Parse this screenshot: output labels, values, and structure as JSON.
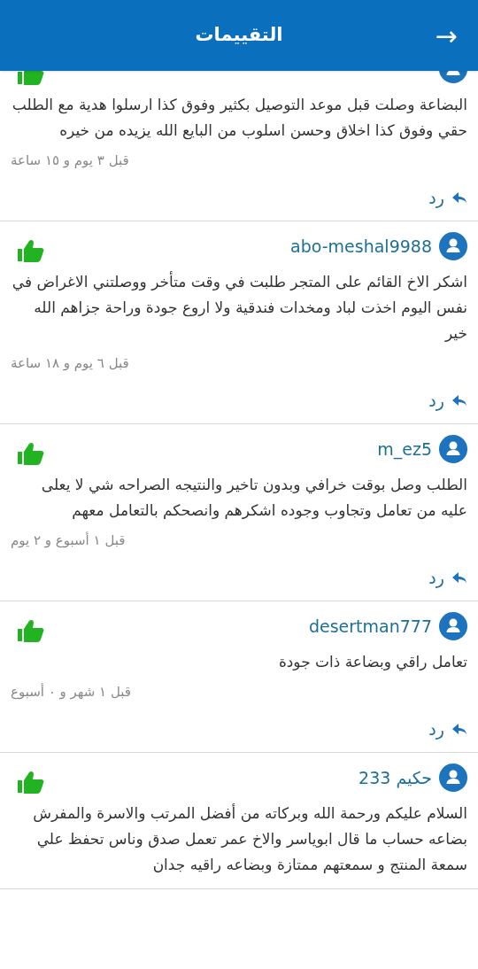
{
  "header": {
    "title": "التقييمات",
    "back_icon": "→"
  },
  "reviews": [
    {
      "text": "البضاعة وصلت قبل موعد التوصيل بكثير    وفوق كذا ارسلوا هدية مع الطلب حقي وفوق كذا اخلاق وحسن اسلوب من البايع الله يزيده من خيره",
      "time": "قبل ٣ يوم و ١٥ ساعة",
      "reply": "رد"
    },
    {
      "username": "abo-meshal9988",
      "text": "اشكر الاخ القائم على المتجر طلبت في وقت متأخر ووصلتني الاغراض في نفس اليوم اخذت لباد ومخدات فندقية ولا اروع جودة وراحة جزاهم الله خير",
      "time": "قبل ٦ يوم و ١٨ ساعة",
      "reply": "رد"
    },
    {
      "username": "m_ez5",
      "text": "الطلب وصل بوقت خرافي وبدون تاخير والنتيجه الصراحه شي لا يعلى عليه من تعامل وتجاوب وجوده اشكرهم وانصحكم بالتعامل معهم",
      "time": "قبل ١ أسبوع و ٢ يوم",
      "reply": "رد"
    },
    {
      "username": "desertman777",
      "text": "تعامل راقي وبضاعة ذات جودة",
      "time": "قبل ١ شهر و ٠ أسبوع",
      "reply": "رد"
    },
    {
      "username": "حكيم 233",
      "text": "السلام عليكم ورحمة الله وبركاته من أفضل المرتب والاسرة والمفرش بضاعه حساب ما قال ابوياسر والاخ عمر تعمل صدق وناس تحفظ علي سمعة المنتج و سمعتهم ممتازة وبضاعه راقيه جدان"
    }
  ]
}
